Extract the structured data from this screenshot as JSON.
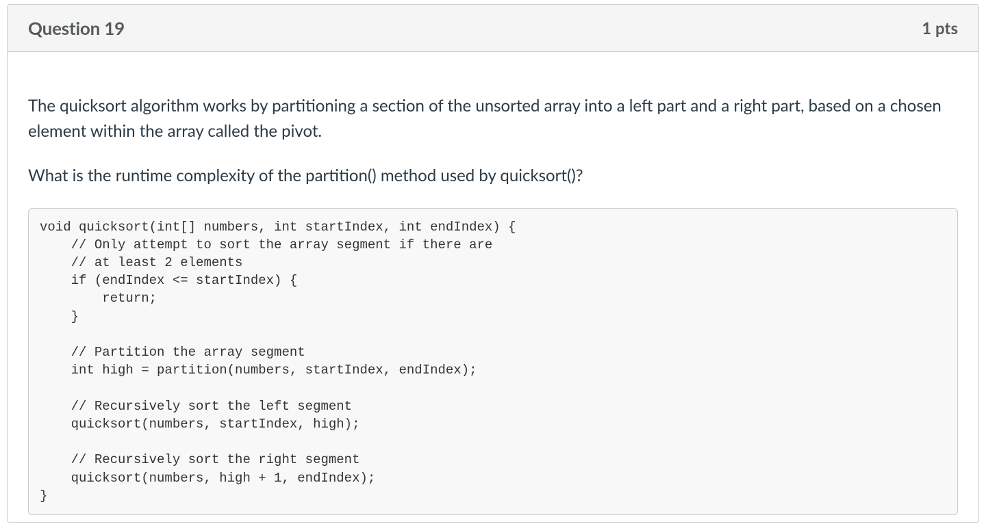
{
  "question": {
    "title": "Question 19",
    "points": "1 pts",
    "prompt_paragraph_1": "The quicksort algorithm works by partitioning a section of the unsorted array into a left part and a right part, based on a chosen element within the array called the pivot.",
    "prompt_paragraph_2": "What is the runtime complexity of the partition() method used by quicksort()?",
    "code": "void quicksort(int[] numbers, int startIndex, int endIndex) {\n    // Only attempt to sort the array segment if there are\n    // at least 2 elements\n    if (endIndex <= startIndex) {\n        return;\n    }\n\n    // Partition the array segment\n    int high = partition(numbers, startIndex, endIndex);\n\n    // Recursively sort the left segment\n    quicksort(numbers, startIndex, high);\n\n    // Recursively sort the right segment\n    quicksort(numbers, high + 1, endIndex);\n}"
  }
}
